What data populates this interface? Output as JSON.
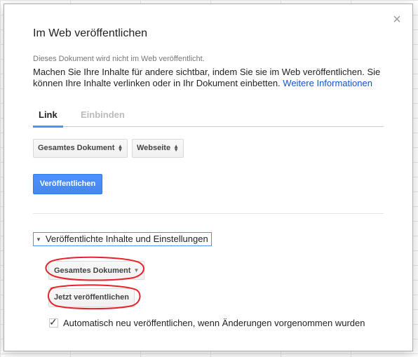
{
  "dialog": {
    "title": "Im Web veröffentlichen",
    "close_glyph": "×",
    "status_text": "Dieses Dokument wird nicht im Web veröffentlicht.",
    "description": "Machen Sie Ihre Inhalte für andere sichtbar, indem Sie sie im Web veröffentlichen. Sie können Ihre Inhalte verlinken oder in Ihr Dokument einbetten.",
    "more_info_link": "Weitere Informationen"
  },
  "tabs": [
    {
      "label": "Link",
      "active": true
    },
    {
      "label": "Einbinden",
      "active": false
    }
  ],
  "selects": {
    "scope": {
      "value": "Gesamtes Dokument"
    },
    "format": {
      "value": "Webseite"
    }
  },
  "publish_button": {
    "label": "Veröffentlichen"
  },
  "published_settings": {
    "toggle_label": "Veröffentlichte Inhalte und Einstellungen",
    "scope_dropdown": "Gesamtes Dokument",
    "publish_now_button": "Jetzt veröffentlichen",
    "auto_republish": {
      "label": "Automatisch neu veröffentlichen, wenn Änderungen vorgenommen wurden",
      "checked": true
    }
  },
  "colors": {
    "accent_blue": "#4d90fe",
    "link_blue": "#1155cc",
    "annotation_red": "#e8212b"
  },
  "icons": {
    "close": "close-icon",
    "select_arrows": "up-down-arrows-icon",
    "toggle": "triangle-down-icon",
    "dropdown": "caret-down-icon",
    "checkbox": "checkmark-icon"
  }
}
